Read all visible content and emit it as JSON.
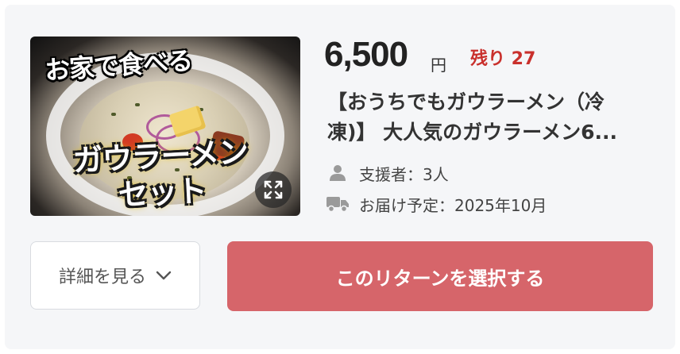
{
  "reward": {
    "image": {
      "overlay_top_text": "お家で食べる",
      "overlay_main_text_line1": "ガウラーメン",
      "overlay_main_text_line2": "セット",
      "expand_icon": "expand-icon"
    },
    "price": "6,500",
    "currency": "円",
    "remaining": "残り 27",
    "title": "【おうちでもガウラーメン（冷凍)】 大人気のガウラーメン6...",
    "supporters": {
      "icon": "person-icon",
      "text": "支援者：3人"
    },
    "delivery": {
      "icon": "truck-icon",
      "text": "お届け予定：2025年10月"
    }
  },
  "actions": {
    "details_label": "詳細を見る",
    "details_icon": "chevron-down-icon",
    "select_label": "このリターンを選択する"
  },
  "colors": {
    "card_background": "#f5f6f8",
    "accent_red": "#c9302c",
    "select_button": "#d6656a"
  }
}
